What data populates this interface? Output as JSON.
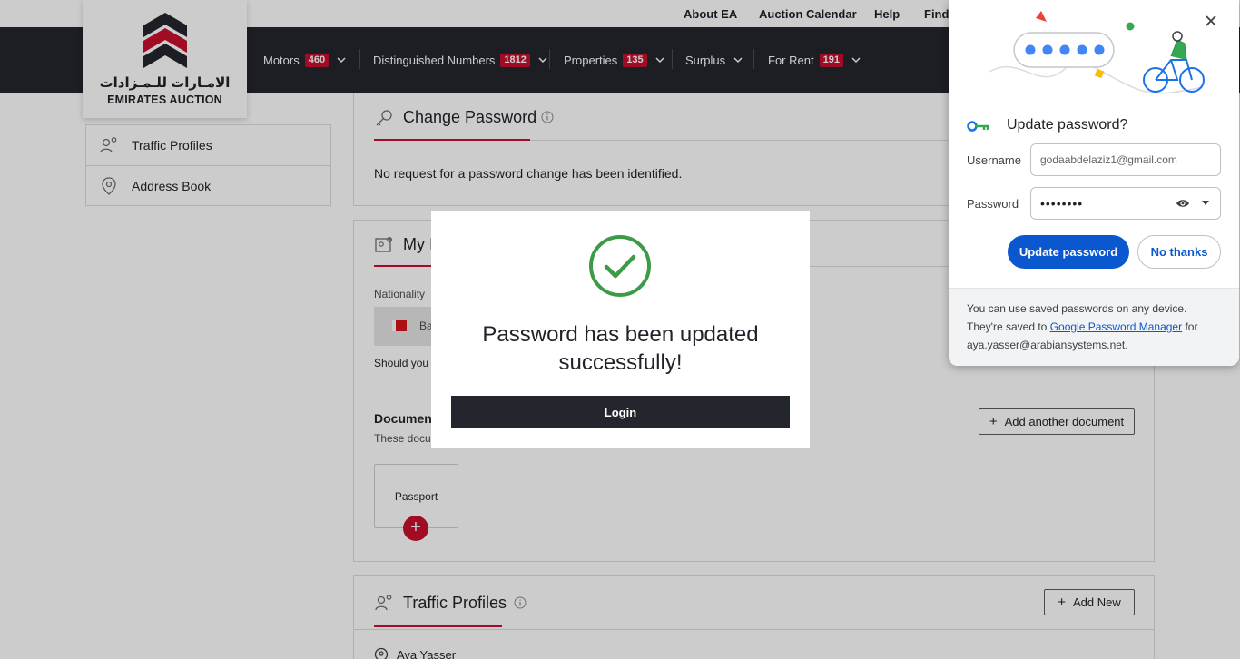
{
  "utility": {
    "about": "About EA",
    "calendar": "Auction Calendar",
    "help": "Help",
    "find": "Find"
  },
  "logo": {
    "arabic": "الامـارات للـمـزادات",
    "english": "EMIRATES AUCTION"
  },
  "nav": [
    {
      "label": "Motors",
      "count": "460"
    },
    {
      "label": "Distinguished Numbers",
      "count": "1812"
    },
    {
      "label": "Properties",
      "count": "135"
    },
    {
      "label": "Surplus",
      "count": ""
    },
    {
      "label": "For Rent",
      "count": "191"
    }
  ],
  "sidebar": {
    "items": [
      {
        "label": "Traffic Profiles",
        "icon": "users-gear-icon"
      },
      {
        "label": "Address Book",
        "icon": "location-pin-icon"
      }
    ]
  },
  "change_password": {
    "title": "Change Password",
    "message": "No request for a password change has been identified."
  },
  "my_info": {
    "title_partial": "My I",
    "nationality_label": "Nationality",
    "nationality_value_partial": "Ba",
    "should_text_partial": "Should you r",
    "documents_title_partial": "Document",
    "documents_sub_partial": "These docu",
    "add_document": "Add another document",
    "passport": "Passport"
  },
  "traffic_profiles": {
    "title": "Traffic Profiles",
    "add_new": "Add New",
    "first_profile": "Aya Yasser"
  },
  "modal": {
    "message": "Password has been updated successfully!",
    "login": "Login"
  },
  "password_popup": {
    "title": "Update password?",
    "username_label": "Username",
    "username_value": "godaabdelaziz1@gmail.com",
    "password_label": "Password",
    "password_value": "••••••••",
    "update_button": "Update password",
    "no_thanks_button": "No thanks",
    "footer_prefix": "You can use saved passwords on any device. They're saved to",
    "footer_link": "Google Password Manager",
    "footer_for": "for",
    "footer_account": "aya.yasser@arabiansystems.net."
  },
  "colors": {
    "brand_red": "#c8102e",
    "nav_dark": "#23262d",
    "google_blue": "#0b57d0",
    "success_green": "#3d9a47"
  }
}
